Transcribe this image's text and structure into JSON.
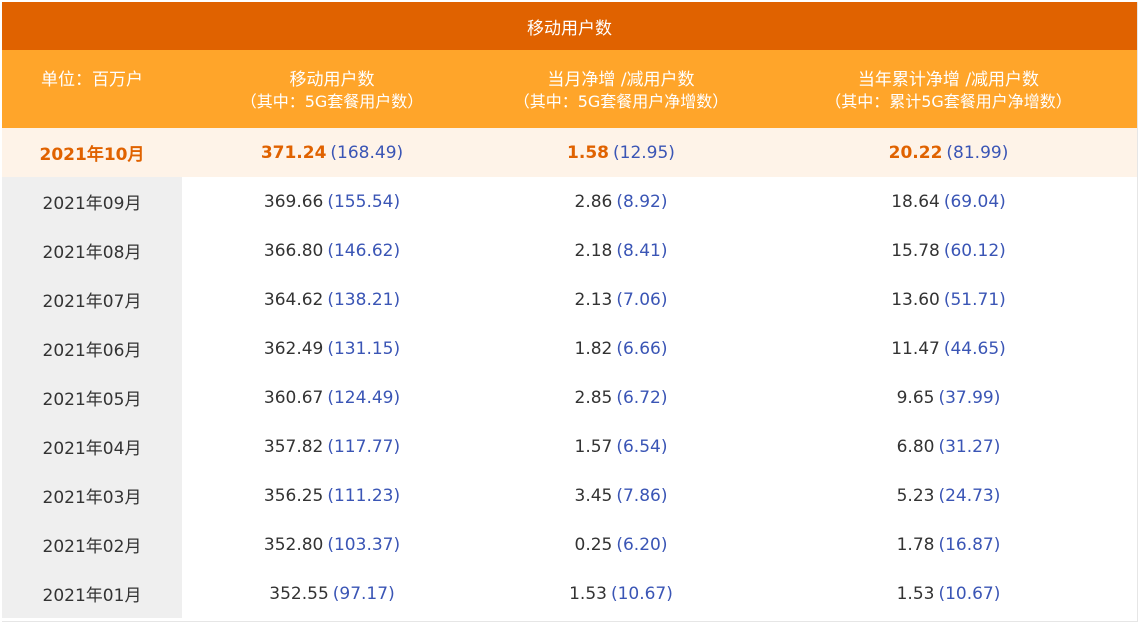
{
  "table": {
    "title": "移动用户数",
    "headers": [
      {
        "label": "单位：百万户",
        "sub": ""
      },
      {
        "label": "移动用户数",
        "sub": "（其中：5G套餐用户数）"
      },
      {
        "label": "当月净增 /减用户数",
        "sub": "（其中：5G套餐用户净增数）"
      },
      {
        "label": "当年累计净增 /减用户数",
        "sub": "（其中：累计5G套餐用户净增数）"
      }
    ],
    "rows": [
      {
        "month": "2021年10月",
        "total": "371.24",
        "total_5g": "(168.49)",
        "net": "1.58",
        "net_5g": "(12.95)",
        "cum": "20.22",
        "cum_5g": "(81.99)"
      },
      {
        "month": "2021年09月",
        "total": "369.66",
        "total_5g": "(155.54)",
        "net": "2.86",
        "net_5g": "(8.92)",
        "cum": "18.64",
        "cum_5g": "(69.04)"
      },
      {
        "month": "2021年08月",
        "total": "366.80",
        "total_5g": "(146.62)",
        "net": "2.18",
        "net_5g": "(8.41)",
        "cum": "15.78",
        "cum_5g": "(60.12)"
      },
      {
        "month": "2021年07月",
        "total": "364.62",
        "total_5g": "(138.21)",
        "net": "2.13",
        "net_5g": "(7.06)",
        "cum": "13.60",
        "cum_5g": "(51.71)"
      },
      {
        "month": "2021年06月",
        "total": "362.49",
        "total_5g": "(131.15)",
        "net": "1.82",
        "net_5g": "(6.66)",
        "cum": "11.47",
        "cum_5g": "(44.65)"
      },
      {
        "month": "2021年05月",
        "total": "360.67",
        "total_5g": "(124.49)",
        "net": "2.85",
        "net_5g": "(6.72)",
        "cum": "9.65",
        "cum_5g": "(37.99)"
      },
      {
        "month": "2021年04月",
        "total": "357.82",
        "total_5g": "(117.77)",
        "net": "1.57",
        "net_5g": "(6.54)",
        "cum": "6.80",
        "cum_5g": "(31.27)"
      },
      {
        "month": "2021年03月",
        "total": "356.25",
        "total_5g": "(111.23)",
        "net": "3.45",
        "net_5g": "(7.86)",
        "cum": "5.23",
        "cum_5g": "(24.73)"
      },
      {
        "month": "2021年02月",
        "total": "352.80",
        "total_5g": "(103.37)",
        "net": "0.25",
        "net_5g": "(6.20)",
        "cum": "1.78",
        "cum_5g": "(16.87)"
      },
      {
        "month": "2021年01月",
        "total": "352.55",
        "total_5g": "(97.17)",
        "net": "1.53",
        "net_5g": "(10.67)",
        "cum": "1.53",
        "cum_5g": "(10.67)"
      }
    ]
  },
  "colors": {
    "title_bg": "#e06200",
    "header_bg": "#ffa52a",
    "highlight_text": "#e06200",
    "highlight_bg": "#fef3e8",
    "sub_value": "#3a55b5",
    "month_col_bg": "#efefef"
  }
}
